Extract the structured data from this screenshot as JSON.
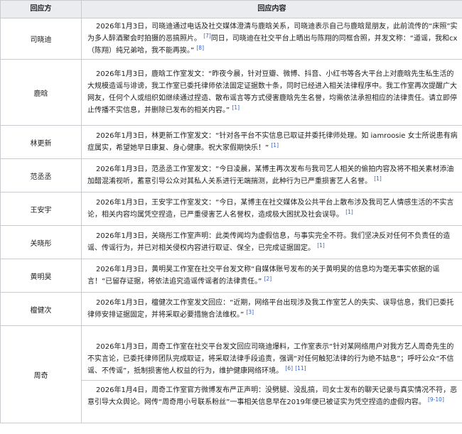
{
  "header": {
    "col1": "回应方",
    "col2": "回应内容"
  },
  "rows": [
    {
      "name": "司晓迪",
      "entries": [
        {
          "text": "2026年1月3日，司晓迪通过电话及社交媒体澄清与鹿晗关系，司晓迪表示自己与鹿晗是朋友，此前流传的“床照”实为多人醉酒聚会时拍摄的恶搞照片。",
          "ref": "[7]",
          "text2": "同日，司晓迪在社交平台上晒出与陈翔的同框合照，并发文称：“道谣，我和cx（陈翔）纯兄弟哈，我不能再挨。”",
          "ref2": "[8]"
        }
      ]
    },
    {
      "name": "鹿晗",
      "entries": [
        {
          "text": "2026年1月3日，鹿晗工作室发文：“昨夜今晨，针对豆瓣、微博、抖音、小红书等各大平台上对鹿晗先生私生活的大规模造谣与诽谤，我工作室已委托律师依法固定证据数十条，同时已经进入相关法律程序中。我工作室再次提醒广大网友，任何个人或组织如继续通过捏造、散布谣言等方式侵害鹿晗先生名誉，均需依法承担相应的法律责任。请立即停止传播不实信息，并删除已发布的相关内容。”",
          "ref": "[1]"
        }
      ]
    },
    {
      "name": "林更新",
      "entries": [
        {
          "text": "2026年1月3日，林更新工作室发文：“针对各平台不实信息已取证并委托律师处理。如 iamroosie 女士所说患有病症属实，希望她早日康复、身心健康。祝大家假期快乐！”",
          "ref": "[1]"
        }
      ]
    },
    {
      "name": "范丞丞",
      "entries": [
        {
          "text": "2026年1月3日，范丞丞工作室发文：“今日凌晨，某博主再次发布与我司艺人相关的偷拍内容及将不相关素材添油加醋混淆视听，蓄意引导公众对其私人关系进行无端揣测，此种行为已严重损害艺人名誉。",
          "ref": "[1]"
        }
      ]
    },
    {
      "name": "王安宇",
      "entries": [
        {
          "text": "2026年1月3日，王安宇工作室发文：“今日，某博主在社交媒体及公共平台上散布涉及我司艺人情感生活的不实言论，相关内容均属凭空捏造，已严重侵害艺人名誉权，造成极大困扰及社会误导。",
          "ref": "[1]"
        }
      ]
    },
    {
      "name": "关晓彤",
      "entries": [
        {
          "text": "2026年1月3日，关晓彤工作室声明：此类传闻均为虚假信息，与事实完全不符。我们坚决反对任何不负责任的造谣、传谣行为，并已对相关侵权内容进行取证、保全，已完成证据固定。",
          "ref": "[1]"
        }
      ]
    },
    {
      "name": "黄明昊",
      "entries": [
        {
          "text": "2026年1月3日，黄明昊工作室在社交平台发文称“自媒体账号发布的关于黄明昊的信息均为毫无事实依据的谣言！”已留存证据，将依法追究造谣传谣者的法律责任。”",
          "ref": "[2]"
        }
      ]
    },
    {
      "name": "檀健次",
      "entries": [
        {
          "text": "2026年1月3日，檀健次工作室发文回应：“近期，网络平台出现涉及我工作室艺人的失实、误导信息，我们已委托律师安排证据固定，并将采取必要措施合法维权。”",
          "ref": "[3]"
        }
      ]
    },
    {
      "name": "周奇",
      "entries": [
        {
          "text": "2026年1月3日，周奇工作室在社交平台发文回应司晓迪爆料，工作室表示“针对某网络用户对我方艺人周奇先生的不实言论，已委托律师团队完成取证，将采取法律手段追责，强调“对任何触犯法律的行为绝不姑息”；呼吁公众“不信谣、不传谣”，抵制损害他人权益的行为，维护健康网络环境。",
          "ref": "[6]",
          "ref2": "[11]"
        },
        {
          "text": "2026年1月4日，周奇工作室官方微博发布严正声明：没劈腿、没乱搞，司女士发布的聊天记录与真实情况不符，恶意引导大众舆论。网传“周奇用小号联系粉丝”一事相关信息早在2019年便已被证实为凭空捏造的虚假内容。",
          "ref": "[9-10]"
        }
      ]
    }
  ]
}
